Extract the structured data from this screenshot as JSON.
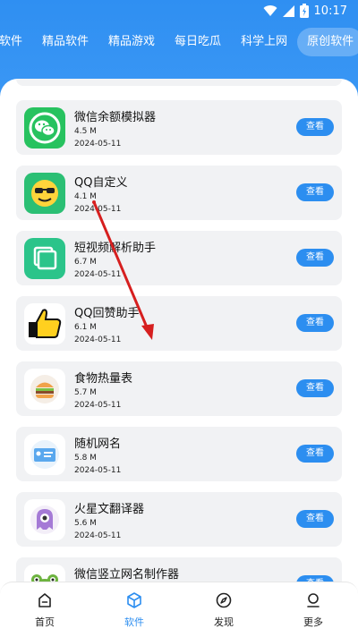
{
  "status_bar": {
    "time": "10:17"
  },
  "tabs": [
    {
      "label": "软件",
      "active": false
    },
    {
      "label": "精品软件",
      "active": false
    },
    {
      "label": "精品游戏",
      "active": false
    },
    {
      "label": "每日吃瓜",
      "active": false
    },
    {
      "label": "科学上网",
      "active": false
    },
    {
      "label": "原创软件",
      "active": true
    }
  ],
  "view_label": "查看",
  "apps": [
    {
      "name": "微信余额模拟器",
      "size": "4.5 M",
      "date": "2024-05-11",
      "icon": "wechat-icon",
      "icon_bg": "#27c25f"
    },
    {
      "name": "QQ自定义",
      "size": "4.1 M",
      "date": "2024-05-11",
      "icon": "sunglasses-emoji-icon",
      "icon_bg": "#2bbf74"
    },
    {
      "name": "短视频解析助手",
      "size": "6.7 M",
      "date": "2024-05-11",
      "icon": "copy-icon",
      "icon_bg": "#2bc48a"
    },
    {
      "name": "QQ回赞助手",
      "size": "6.1 M",
      "date": "2024-05-11",
      "icon": "thumbs-up-icon",
      "icon_bg": "#ffffff"
    },
    {
      "name": "食物热量表",
      "size": "5.7 M",
      "date": "2024-05-11",
      "icon": "burger-icon",
      "icon_bg": "#ffffff"
    },
    {
      "name": "随机网名",
      "size": "5.8 M",
      "date": "2024-05-11",
      "icon": "id-card-icon",
      "icon_bg": "#ffffff"
    },
    {
      "name": "火星文翻译器",
      "size": "5.6 M",
      "date": "2024-05-11",
      "icon": "alien-icon",
      "icon_bg": "#ffffff"
    },
    {
      "name": "微信竖立网名制作器",
      "size": "",
      "date": "",
      "icon": "frog-icon",
      "icon_bg": "#ffffff"
    }
  ],
  "bottom_nav": [
    {
      "label": "首页",
      "icon": "home-icon",
      "active": false
    },
    {
      "label": "软件",
      "icon": "cube-icon",
      "active": true
    },
    {
      "label": "发现",
      "icon": "compass-icon",
      "active": false
    },
    {
      "label": "更多",
      "icon": "user-icon",
      "active": false
    }
  ],
  "colors": {
    "header": "#3393f3",
    "accent": "#2c8ef0",
    "card": "#f1f2f4",
    "annotation_arrow": "#d61f1f"
  }
}
